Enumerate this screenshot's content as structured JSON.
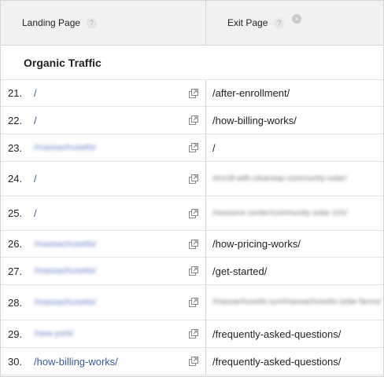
{
  "header": {
    "landing_label": "Landing Page",
    "exit_label": "Exit Page",
    "help_glyph": "?",
    "close_glyph": "×"
  },
  "section_title": "Organic Traffic",
  "rows": [
    {
      "num": "21.",
      "landing": "/",
      "landing_blurred": false,
      "exit": "/after-enrollment/",
      "exit_blurred": false,
      "h": 34
    },
    {
      "num": "22.",
      "landing": "/",
      "landing_blurred": false,
      "exit": "/how-billing-works/",
      "exit_blurred": false,
      "h": 35
    },
    {
      "num": "23.",
      "landing": "/massachusetts/",
      "landing_blurred": true,
      "exit": "/",
      "exit_blurred": false,
      "h": 35
    },
    {
      "num": "24.",
      "landing": "/",
      "landing_blurred": false,
      "exit": "/enroll-with-clearway-community-solar/",
      "exit_blurred": true,
      "h": 44
    },
    {
      "num": "25.",
      "landing": "/",
      "landing_blurred": false,
      "exit": "/resource-center/community-solar-101/",
      "exit_blurred": true,
      "h": 44
    },
    {
      "num": "26.",
      "landing": "/massachusetts/",
      "landing_blurred": true,
      "exit": "/how-pricing-works/",
      "exit_blurred": false,
      "h": 34
    },
    {
      "num": "27.",
      "landing": "/massachusetts/",
      "landing_blurred": true,
      "exit": "/get-started/",
      "exit_blurred": false,
      "h": 35
    },
    {
      "num": "28.",
      "landing": "/massachusetts/",
      "landing_blurred": true,
      "exit": "/massachusetts-sun/massachusetts-solar-farms/",
      "exit_blurred": true,
      "h": 45
    },
    {
      "num": "29.",
      "landing": "/new-york/",
      "landing_blurred": true,
      "exit": "/frequently-asked-questions/",
      "exit_blurred": false,
      "h": 35
    },
    {
      "num": "30.",
      "landing": "/how-billing-works/",
      "landing_blurred": false,
      "exit": "/frequently-asked-questions/",
      "exit_blurred": false,
      "h": 35
    }
  ],
  "icons": {
    "external": "open-in-new-window-icon"
  }
}
